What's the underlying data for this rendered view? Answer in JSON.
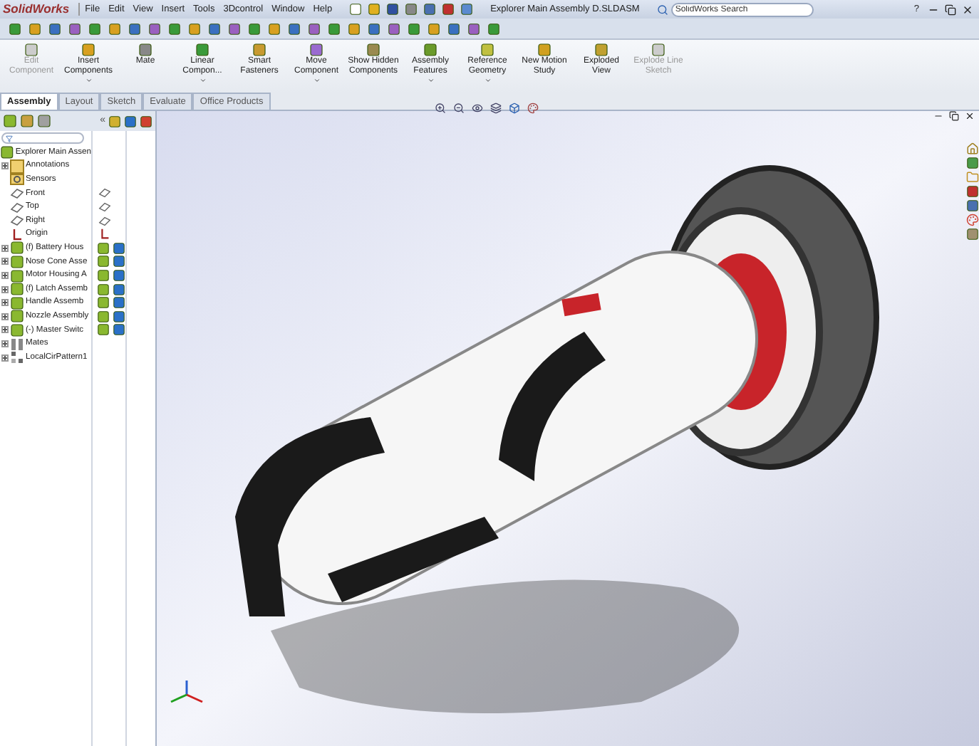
{
  "title_bar": {
    "app_name": "SolidWorks",
    "menus": [
      "File",
      "Edit",
      "View",
      "Insert",
      "Tools",
      "3Dcontrol",
      "Window",
      "Help"
    ],
    "document_title": "Explorer Main Assembly D.SLDASM",
    "search": {
      "placeholder": "SolidWorks Search"
    },
    "help": "?"
  },
  "ribbon": {
    "buttons": [
      {
        "label": "Edit Component",
        "disabled": true,
        "has_menu": false
      },
      {
        "label": "Insert Components",
        "disabled": false,
        "has_menu": true
      },
      {
        "label": "Mate",
        "disabled": false,
        "has_menu": false
      },
      {
        "label": "Linear Compon...",
        "disabled": false,
        "has_menu": true
      },
      {
        "label": "Smart Fasteners",
        "disabled": false,
        "has_menu": false
      },
      {
        "label": "Move Component",
        "disabled": false,
        "has_menu": true
      },
      {
        "label": "Show Hidden Components",
        "disabled": false,
        "has_menu": false
      },
      {
        "label": "Assembly Features",
        "disabled": false,
        "has_menu": true
      },
      {
        "label": "Reference Geometry",
        "disabled": false,
        "has_menu": true
      },
      {
        "label": "New Motion Study",
        "disabled": false,
        "has_menu": false
      },
      {
        "label": "Exploded View",
        "disabled": false,
        "has_menu": false
      },
      {
        "label": "Explode Line Sketch",
        "disabled": true,
        "has_menu": false
      }
    ]
  },
  "tabs": [
    {
      "label": "Assembly",
      "selected": true
    },
    {
      "label": "Layout",
      "selected": false
    },
    {
      "label": "Sketch",
      "selected": false
    },
    {
      "label": "Evaluate",
      "selected": false
    },
    {
      "label": "Office Products",
      "selected": false
    }
  ],
  "feature_tree": {
    "collapse": "«",
    "root": {
      "label": "Explorer Main Assen",
      "kind": "assembly",
      "children": [
        {
          "label": "Annotations",
          "kind": "annotations",
          "expanded": false
        },
        {
          "label": "Sensors",
          "kind": "sensors"
        },
        {
          "label": "Front",
          "kind": "plane"
        },
        {
          "label": "Top",
          "kind": "plane"
        },
        {
          "label": "Right",
          "kind": "plane"
        },
        {
          "label": "Origin",
          "kind": "origin"
        },
        {
          "label": "(f) Battery Hous",
          "kind": "subassembly",
          "expanded": false
        },
        {
          "label": "Nose Cone Asse",
          "kind": "subassembly",
          "expanded": false
        },
        {
          "label": "Motor Housing A",
          "kind": "subassembly",
          "expanded": false
        },
        {
          "label": "(f) Latch Assemb",
          "kind": "subassembly",
          "expanded": false
        },
        {
          "label": "Handle Assemb",
          "kind": "subassembly",
          "expanded": false
        },
        {
          "label": "Nozzle Assembly",
          "kind": "subassembly",
          "expanded": false
        },
        {
          "label": "(-) Master Switc",
          "kind": "subassembly",
          "expanded": false
        },
        {
          "label": "Mates",
          "kind": "mates",
          "expanded": false
        },
        {
          "label": "LocalCirPattern1",
          "kind": "pattern",
          "expanded": false
        }
      ]
    }
  }
}
